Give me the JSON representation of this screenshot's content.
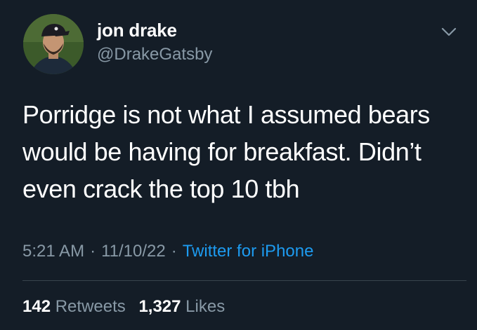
{
  "author": {
    "name": "jon drake",
    "handle": "@DrakeGatsby",
    "avatar_icon": "profile-photo"
  },
  "menu_icon": "chevron-down-icon",
  "tweet": {
    "text": "Porridge is not what I assumed bears\nwould be having for breakfast. Didn’t\neven crack the top 10 tbh",
    "time": "5:21 AM",
    "separator": "·",
    "date": "11/10/22",
    "source": "Twitter for iPhone"
  },
  "stats": {
    "retweets_count": "142",
    "retweets_label": "Retweets",
    "likes_count": "1,327",
    "likes_label": "Likes"
  },
  "colors": {
    "background": "#141d27",
    "secondary_text": "#8899a6",
    "link": "#1d9bf0",
    "divider": "#38444d"
  }
}
